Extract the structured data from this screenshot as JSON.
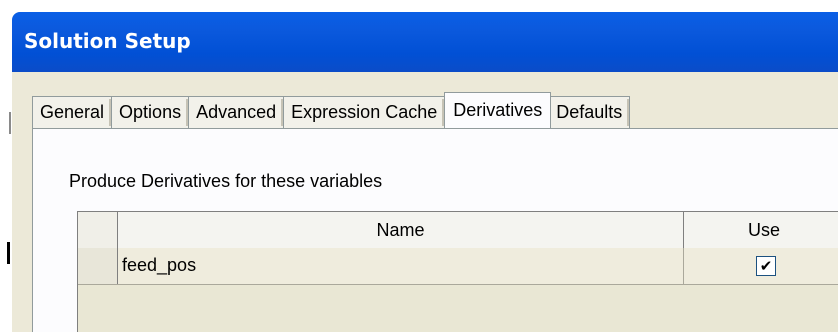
{
  "window": {
    "title": "Solution Setup"
  },
  "tabs": [
    {
      "label": "General"
    },
    {
      "label": "Options"
    },
    {
      "label": "Advanced"
    },
    {
      "label": "Expression Cache"
    },
    {
      "label": "Derivatives",
      "active": true
    },
    {
      "label": "Defaults"
    }
  ],
  "panel": {
    "caption": "Produce Derivatives for these variables"
  },
  "grid": {
    "columns": [
      "Name",
      "Use"
    ],
    "rows": [
      {
        "name": "feed_pos",
        "use": true,
        "use_glyph": "✔"
      }
    ]
  },
  "colors": {
    "titlebar": "#0150d5",
    "dialog_bg": "#ece9d8",
    "panel_bg": "#fcfcfe",
    "row_bg": "#efecdd"
  }
}
